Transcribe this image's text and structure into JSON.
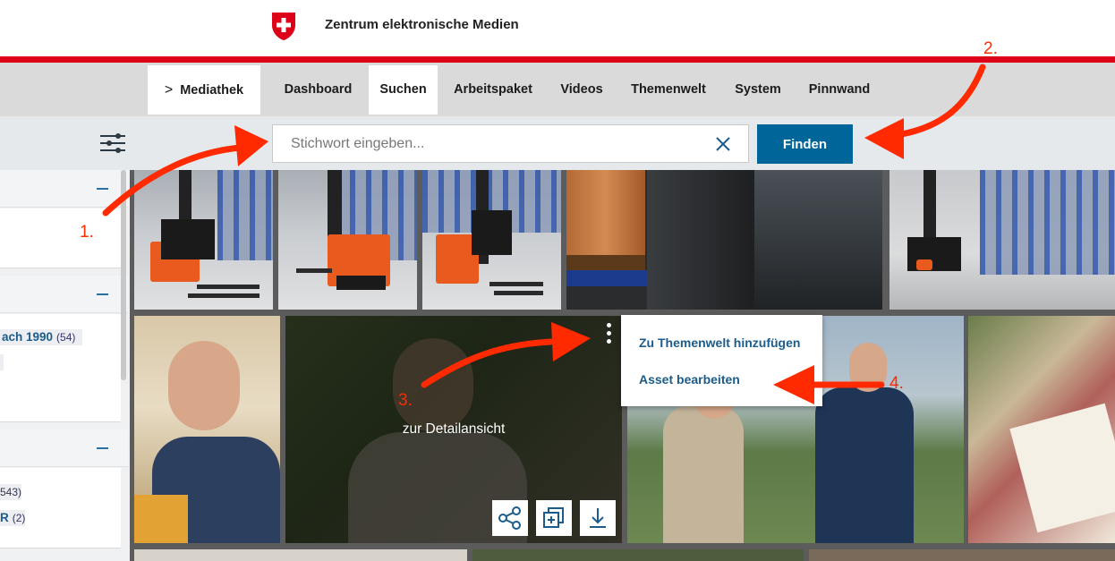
{
  "header": {
    "site_title": "Zentrum elektronische Medien",
    "logo": "swiss-coat-of-arms"
  },
  "nav": {
    "items": [
      {
        "label": "Mediathek",
        "icon": "chevron-right-icon"
      },
      {
        "label": "Dashboard"
      },
      {
        "label": "Suchen",
        "active": true
      },
      {
        "label": "Arbeitspaket"
      },
      {
        "label": "Videos"
      },
      {
        "label": "Themenwelt"
      },
      {
        "label": "System"
      },
      {
        "label": "Pinnwand"
      }
    ]
  },
  "search": {
    "placeholder": "Stichwort eingeben...",
    "value": "",
    "find_label": "Finden"
  },
  "sidebar": {
    "items": [
      {
        "label": "ach 1990",
        "count": "(54)"
      },
      {
        "label": "543)"
      },
      {
        "label": "R",
        "count": "(2)"
      }
    ]
  },
  "card": {
    "overlay_label": "zur Detailansicht",
    "actions": [
      "share-icon",
      "add-to-collection-icon",
      "download-icon"
    ]
  },
  "context_menu": {
    "items": [
      {
        "label": "Zu Themenwelt hinzufügen"
      },
      {
        "label": "Asset bearbeiten"
      }
    ]
  },
  "annotations": {
    "labels": [
      "1.",
      "2.",
      "3.",
      "4."
    ]
  },
  "colors": {
    "brand_red": "#dc0018",
    "primary_blue": "#006699",
    "link_blue": "#1b5c8c",
    "annotation_red": "#ff2a00"
  }
}
